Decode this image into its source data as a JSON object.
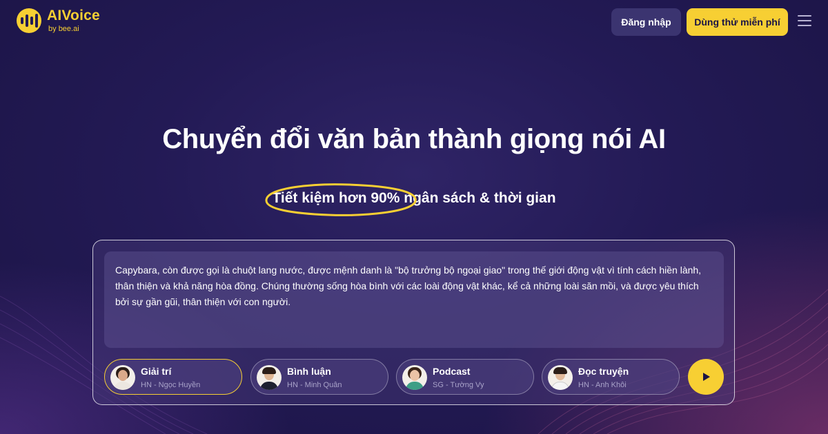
{
  "brand": {
    "name": "AIVoice",
    "by": "by",
    "partner": "bee.ai",
    "accent": "#f7cf33",
    "background": "#231a55"
  },
  "header": {
    "login_label": "Đăng nhập",
    "try_label": "Dùng thử miễn phí",
    "menu_icon": "hamburger-menu-icon"
  },
  "hero": {
    "title": "Chuyển đổi văn bản thành giọng nói AI",
    "highlight": "Tiết kiệm hơn 90%",
    "subtitle_rest": " ngân sách & thời gian"
  },
  "editor": {
    "text": "Capybara, còn được gọi là chuột lang nước, được mệnh danh là \"bộ trưởng bộ ngoại giao\" trong thế giới động vật vì tính cách hiền lành, thân thiện và khả năng hòa đồng. Chúng thường sống hòa bình với các loài động vật khác, kể cả những loài săn mồi, và được yêu thích bởi sự gần gũi, thân thiện với con người."
  },
  "voices": [
    {
      "category": "Giải trí",
      "speaker": "HN - Ngọc Huyền",
      "selected": true
    },
    {
      "category": "Bình luận",
      "speaker": "HN - Minh Quân",
      "selected": false
    },
    {
      "category": "Podcast",
      "speaker": "SG - Tường Vy",
      "selected": false
    },
    {
      "category": "Đọc truyện",
      "speaker": "HN - Anh Khôi",
      "selected": false
    }
  ],
  "play_icon": "play-icon"
}
